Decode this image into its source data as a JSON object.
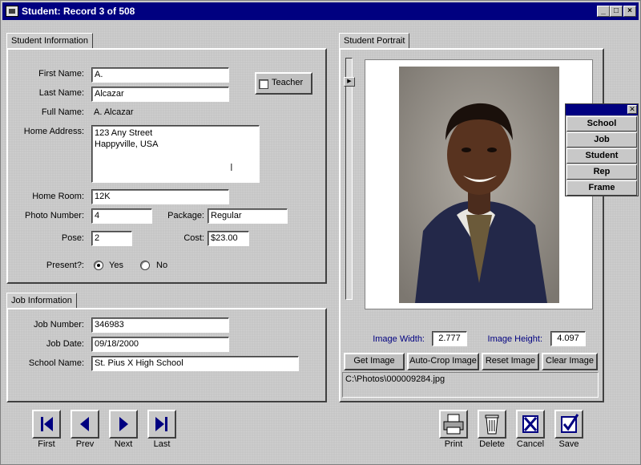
{
  "window": {
    "title": "Student: Record 3 of 508"
  },
  "student_info": {
    "tab_label": "Student Information",
    "first_name_label": "First Name:",
    "first_name": "A.",
    "last_name_label": "Last Name:",
    "last_name": "Alcazar",
    "full_name_label": "Full Name:",
    "full_name": "A. Alcazar",
    "home_address_label": "Home Address:",
    "home_address": "123 Any Street\nHappyville, USA",
    "home_room_label": "Home Room:",
    "home_room": "12K",
    "photo_number_label": "Photo Number:",
    "photo_number": "4",
    "package_label": "Package:",
    "package": "Regular",
    "pose_label": "Pose:",
    "pose": "2",
    "cost_label": "Cost:",
    "cost": "$23.00",
    "present_label": "Present?:",
    "present_yes": "Yes",
    "present_no": "No",
    "present_selected": "Yes",
    "teacher_label": "Teacher",
    "teacher_checked": false
  },
  "job_info": {
    "tab_label": "Job Information",
    "job_number_label": "Job Number:",
    "job_number": "346983",
    "job_date_label": "Job Date:",
    "job_date": "09/18/2000",
    "school_name_label": "School Name:",
    "school_name": "St. Pius X High School"
  },
  "portrait": {
    "tab_label": "Student Portrait",
    "image_width_label": "Image Width:",
    "image_width": "2.777",
    "image_height_label": "Image Height:",
    "image_height": "4.097",
    "get_image": "Get Image",
    "auto_crop": "Auto-Crop Image",
    "reset_image": "Reset Image",
    "clear_image": "Clear Image",
    "file_path": "C:\\Photos\\000009284.jpg"
  },
  "palette": {
    "items": [
      "School",
      "Job",
      "Student",
      "Rep",
      "Frame"
    ]
  },
  "nav": {
    "first": "First",
    "prev": "Prev",
    "next": "Next",
    "last": "Last"
  },
  "actions": {
    "print": "Print",
    "delete": "Delete",
    "cancel": "Cancel",
    "save": "Save"
  },
  "colors": {
    "title_bar": "#000080",
    "blue_label": "#000080"
  }
}
